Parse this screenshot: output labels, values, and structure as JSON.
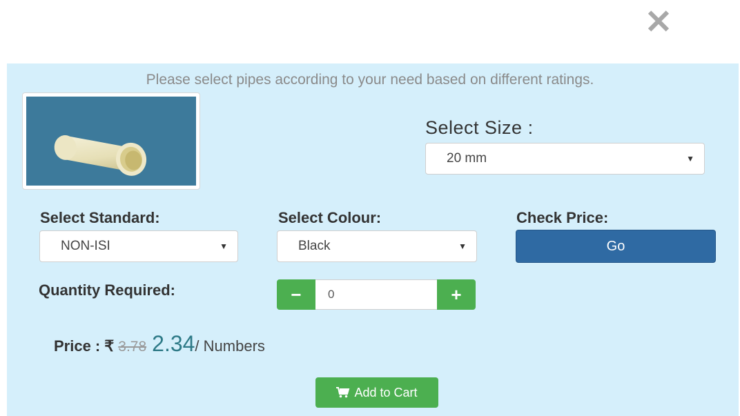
{
  "modal": {
    "close_glyph": "✕"
  },
  "intro_text": "Please select pipes according to your need based on different ratings.",
  "product_image": {
    "icon": "pipe-image",
    "background": "#3d7a9b",
    "pipe_color": "#e9e3bf"
  },
  "size": {
    "label": "Select Size :",
    "selected": "20 mm"
  },
  "standard": {
    "label": "Select Standard:",
    "selected": "NON-ISI"
  },
  "colour": {
    "label": "Select Colour:",
    "selected": "Black"
  },
  "check_price": {
    "label": "Check Price:",
    "button": "Go"
  },
  "quantity": {
    "label": "Quantity Required:",
    "value": "0",
    "minus": "−",
    "plus": "+"
  },
  "price": {
    "label": "Price :",
    "currency": "₹",
    "old": "3.78",
    "new": "2.34",
    "unit": "/ Numbers"
  },
  "cart": {
    "icon": "shopping-cart-icon",
    "label": "Add to Cart"
  },
  "colors": {
    "panel": "#d5effb",
    "primary": "#2f6aa3",
    "success": "#4caf50",
    "price": "#2e7a87"
  }
}
